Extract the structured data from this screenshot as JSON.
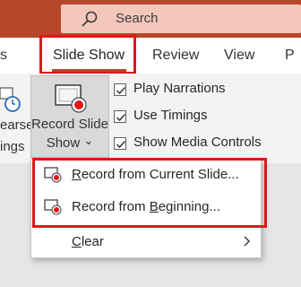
{
  "header": {
    "search_placeholder": "Search"
  },
  "tabs": {
    "partial_left": "s",
    "slide_show": "Slide Show",
    "review": "Review",
    "view": "View",
    "partial_right": "P"
  },
  "ribbon": {
    "rehearse_line1": "earse",
    "rehearse_line2": "ings",
    "record_line1": "Record Slide",
    "record_line2": "Show",
    "record_dropdown_glyph": "⌄",
    "checkboxes": [
      {
        "label": "Play Narrations",
        "checked": true
      },
      {
        "label": "Use Timings",
        "checked": true
      },
      {
        "label": "Show Media Controls",
        "checked": true
      }
    ]
  },
  "menu": {
    "items": [
      {
        "prefix": "",
        "accel": "R",
        "suffix": "ecord from Current Slide..."
      },
      {
        "prefix": "Record from ",
        "accel": "B",
        "suffix": "eginning..."
      },
      {
        "prefix": "",
        "accel": "C",
        "suffix": "lear"
      }
    ],
    "submenu_glyph": "›"
  },
  "colors": {
    "accent": "#b7472a",
    "highlight_red": "#e2161c"
  }
}
